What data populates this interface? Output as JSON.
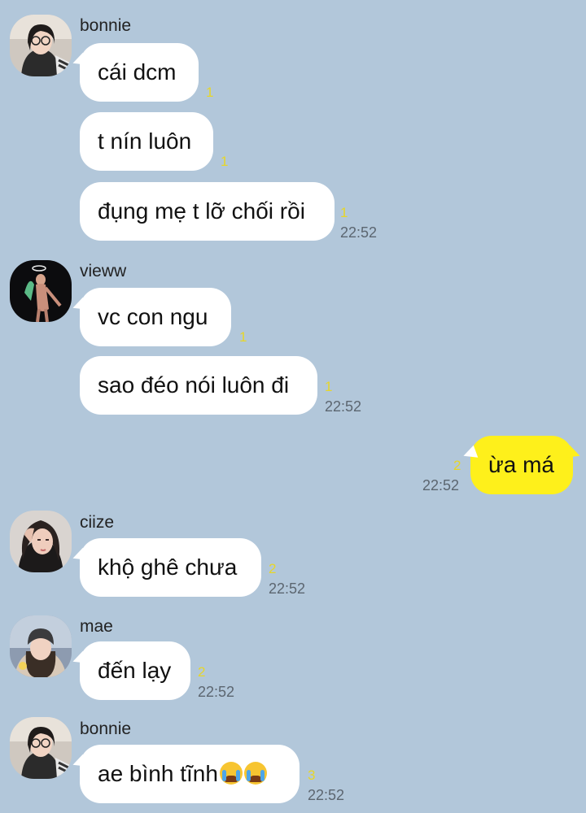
{
  "chat": {
    "groups": [
      {
        "sender": "bonnie",
        "avatar": "avatar-girl-glasses",
        "messages": [
          {
            "text": "cái dcm",
            "unread": "1"
          },
          {
            "text": "t nín luôn",
            "unread": "1"
          },
          {
            "text": "đụng mẹ t lỡ chối rồi",
            "unread": "1",
            "time": "22:52"
          }
        ]
      },
      {
        "sender": "vieww",
        "avatar": "avatar-night-figure",
        "messages": [
          {
            "text": "vc con ngu",
            "unread": "1"
          },
          {
            "text": "sao đéo nói luôn đi",
            "unread": "1",
            "time": "22:52"
          }
        ]
      },
      {
        "sender": "me",
        "messages": [
          {
            "text": "ừa má",
            "unread": "2",
            "time": "22:52"
          }
        ]
      },
      {
        "sender": "ciize",
        "avatar": "avatar-girl-portrait",
        "messages": [
          {
            "text": "khộ ghê chưa",
            "unread": "2",
            "time": "22:52"
          }
        ]
      },
      {
        "sender": "mae",
        "avatar": "avatar-girl-beanie",
        "messages": [
          {
            "text": "đến lạy",
            "unread": "2",
            "time": "22:52"
          }
        ]
      },
      {
        "sender": "bonnie",
        "avatar": "avatar-girl-glasses",
        "messages": [
          {
            "text": "ae bình tĩnh",
            "emoji": [
              "loudly-crying-face",
              "loudly-crying-face"
            ],
            "unread": "3",
            "time": "22:52"
          }
        ]
      }
    ]
  },
  "colors": {
    "background": "#b2c7da",
    "bubble_other": "#ffffff",
    "bubble_me": "#fef01b",
    "unread_count": "#e7d629",
    "timestamp": "#5c6670"
  }
}
